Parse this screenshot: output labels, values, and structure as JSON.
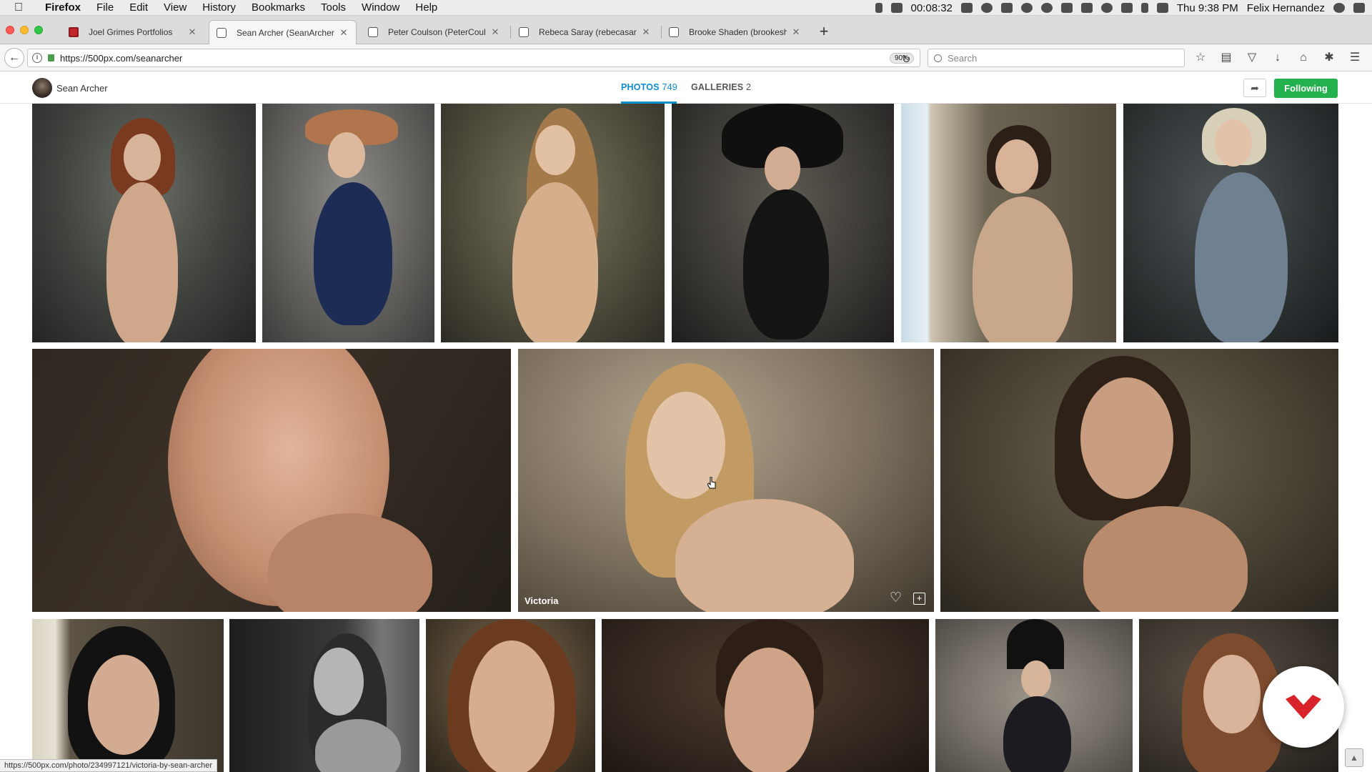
{
  "menubar": {
    "app_name": "Firefox",
    "items": [
      "File",
      "Edit",
      "View",
      "History",
      "Bookmarks",
      "Tools",
      "Window",
      "Help"
    ],
    "timer": "00:08:32",
    "clock": "Thu 9:38 PM",
    "user": "Felix Hernandez"
  },
  "tabs": [
    {
      "title": "Joel Grimes Portfolios",
      "favicon": "red-square-icon"
    },
    {
      "title": "Sean Archer (SeanArcher) Ph",
      "favicon": "500px-icon"
    },
    {
      "title": "Peter Coulson (PeterCoulson)",
      "favicon": "500px-icon"
    },
    {
      "title": "Rebeca Saray (rebecasaray)",
      "favicon": "500px-icon"
    },
    {
      "title": "Brooke Shaden (brookeshade",
      "favicon": "500px-icon"
    }
  ],
  "navbar": {
    "url": "https://500px.com/seanarcher",
    "zoom": "90%",
    "search_placeholder": "Search"
  },
  "profile": {
    "name": "Sean Archer",
    "photos_label": "PHOTOS",
    "photos_count": "749",
    "galleries_label": "GALLERIES",
    "galleries_count": "2",
    "following_label": "Following"
  },
  "hovered_photo": {
    "title": "Victoria"
  },
  "status_url": "https://500px.com/photo/234997121/victoria-by-sean-archer",
  "colors": {
    "accent_blue": "#0b8fd1",
    "follow_green": "#22b14c",
    "brand_red": "#d8232a"
  }
}
